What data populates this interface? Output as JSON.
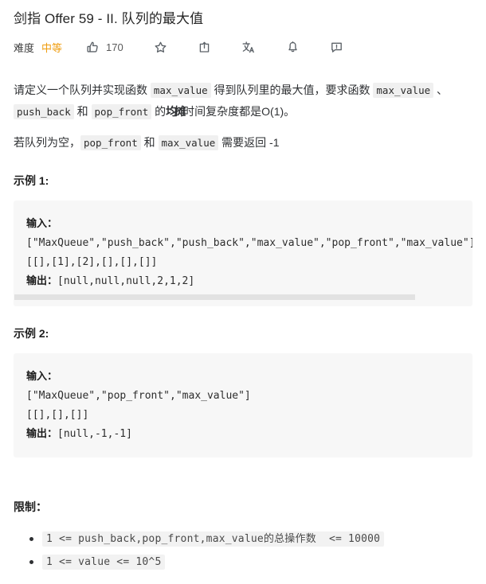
{
  "problem": {
    "title": "剑指 Offer 59 - II. 队列的最大值",
    "difficulty_label": "难度",
    "difficulty_value": "中等",
    "difficulty_color": "#ef9d10"
  },
  "actions": {
    "like_count": "170",
    "like_icon": "thumbs-up-icon",
    "favorite_icon": "star-icon",
    "share_icon": "share-icon",
    "translate_icon": "translate-icon",
    "notify_icon": "bell-icon",
    "feedback_icon": "feedback-icon"
  },
  "description": {
    "p1_part1": "请定义一个队列并实现函数 ",
    "p1_code1": "max_value",
    "p1_part2": " 得到队列里的最大值，要求函数 ",
    "p1_code2": "max_value",
    "p1_part3": " 、 ",
    "p1_code3": "push_back",
    "p1_part4": " 和 ",
    "p1_code4": "pop_front",
    "p1_part5": " 的",
    "p1_emphasis": "均摊",
    "p1_part6": "时间复杂度都是O(1)。",
    "p2_part1": "若队列为空，",
    "p2_code1": "pop_front",
    "p2_part2": " 和 ",
    "p2_code2": "max_value",
    "p2_part3": " 需要返回 -1"
  },
  "examples": [
    {
      "heading": "示例 1:",
      "input_label": "输入：",
      "input_line1": "[\"MaxQueue\",\"push_back\",\"push_back\",\"max_value\",\"pop_front\",\"max_value\"]",
      "input_line2": "[[],[1],[2],[],[],[]]",
      "output_label": "输出：",
      "output_value": "[null,null,null,2,1,2]",
      "has_scrollbar": true
    },
    {
      "heading": "示例 2:",
      "input_label": "输入：",
      "input_line1": "[\"MaxQueue\",\"pop_front\",\"max_value\"]",
      "input_line2": "[[],[],[]]",
      "output_label": "输出：",
      "output_value": "[null,-1,-1]",
      "has_scrollbar": false
    }
  ],
  "constraints": {
    "heading": "限制：",
    "items": [
      "1 <= push_back,pop_front,max_value的总操作数  <= 10000",
      "1 <= value <= 10^5"
    ]
  }
}
